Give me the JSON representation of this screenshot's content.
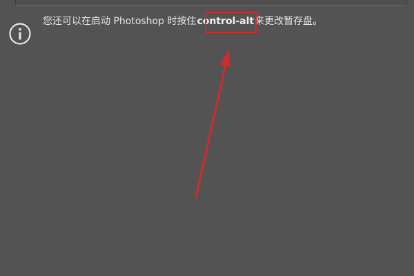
{
  "tip": {
    "before": "您还可以在启动 Photoshop 时按住 ",
    "shortcut": "control-alt",
    "after": " 来更改暂存盘。"
  },
  "icons": {
    "info": "info-icon"
  },
  "annotation": {
    "color": "#d42a2a"
  }
}
